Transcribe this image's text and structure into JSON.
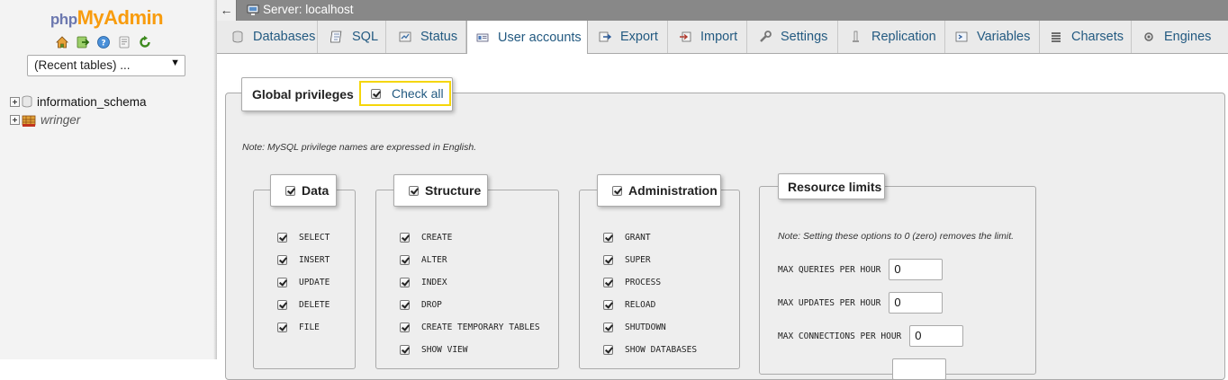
{
  "sidebar": {
    "logo_php": "php",
    "logo_myadmin": "MyAdmin",
    "quick_icons": [
      "home-icon",
      "exit-icon",
      "help-icon",
      "docs-icon",
      "reload-icon"
    ],
    "recent_tables": "(Recent tables) ...",
    "databases": [
      {
        "name": "information_schema",
        "icon": "database-icon",
        "italic": false
      },
      {
        "name": "wringer",
        "icon": "database-stack-icon",
        "italic": true
      }
    ]
  },
  "topbar": {
    "back": "←",
    "server_label": "Server: localhost"
  },
  "tabs": [
    {
      "label": "Databases",
      "icon": "database-icon",
      "active": false
    },
    {
      "label": "SQL",
      "icon": "sql-icon",
      "active": false
    },
    {
      "label": "Status",
      "icon": "status-icon",
      "active": false
    },
    {
      "label": "User accounts",
      "icon": "user-accounts-icon",
      "active": true
    },
    {
      "label": "Export",
      "icon": "export-icon",
      "active": false
    },
    {
      "label": "Import",
      "icon": "import-icon",
      "active": false
    },
    {
      "label": "Settings",
      "icon": "wrench-icon",
      "active": false
    },
    {
      "label": "Replication",
      "icon": "replication-icon",
      "active": false
    },
    {
      "label": "Variables",
      "icon": "variables-icon",
      "active": false
    },
    {
      "label": "Charsets",
      "icon": "charsets-icon",
      "active": false
    },
    {
      "label": "Engines",
      "icon": "engines-icon",
      "active": false
    }
  ],
  "privileges": {
    "legend": "Global privileges",
    "check_all": "Check all",
    "note": "Note: MySQL privilege names are expressed in English.",
    "groups": [
      {
        "title": "Data",
        "items": [
          "SELECT",
          "INSERT",
          "UPDATE",
          "DELETE",
          "FILE"
        ]
      },
      {
        "title": "Structure",
        "items": [
          "CREATE",
          "ALTER",
          "INDEX",
          "DROP",
          "CREATE TEMPORARY TABLES",
          "SHOW VIEW"
        ]
      },
      {
        "title": "Administration",
        "items": [
          "GRANT",
          "SUPER",
          "PROCESS",
          "RELOAD",
          "SHUTDOWN",
          "SHOW DATABASES"
        ]
      }
    ],
    "resource_limits": {
      "title": "Resource limits",
      "note": "Note: Setting these options to 0 (zero) removes the limit.",
      "rows": [
        {
          "label": "MAX QUERIES PER HOUR",
          "value": "0"
        },
        {
          "label": "MAX UPDATES PER HOUR",
          "value": "0"
        },
        {
          "label": "MAX CONNECTIONS PER HOUR",
          "value": "0"
        }
      ]
    }
  }
}
